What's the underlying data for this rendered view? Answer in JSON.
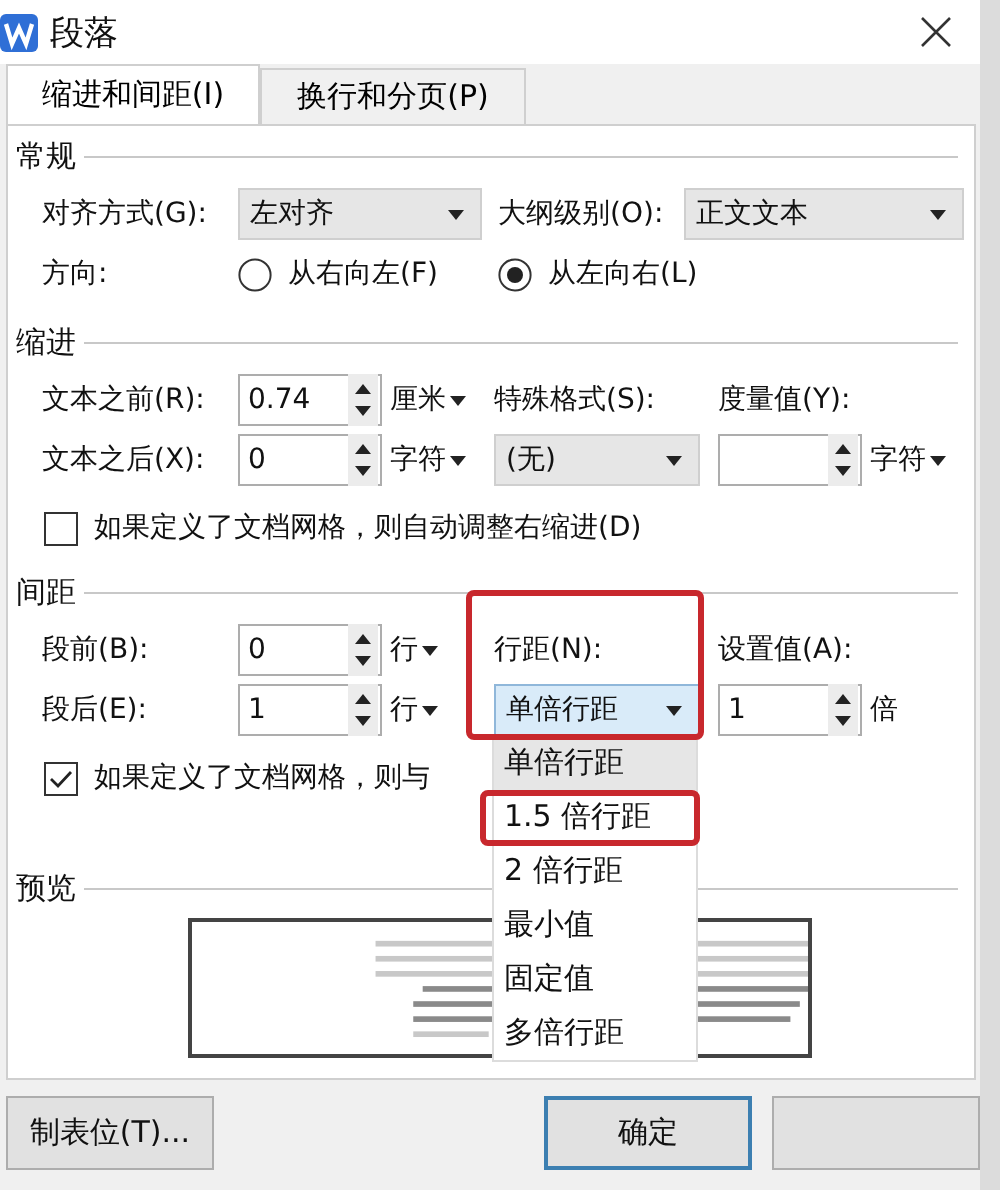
{
  "window": {
    "title": "段落"
  },
  "tabs": [
    {
      "label": "缩进和间距(I)",
      "selected": true
    },
    {
      "label": "换行和分页(P)",
      "selected": false
    }
  ],
  "general": {
    "heading": "常规",
    "alignment": {
      "label": "对齐方式(G):",
      "value": "左对齐"
    },
    "outline_level": {
      "label": "大纲级别(O):",
      "value": "正文文本"
    },
    "direction": {
      "label": "方向:",
      "options": [
        {
          "label": "从右向左(F)",
          "selected": false
        },
        {
          "label": "从左向右(L)",
          "selected": true
        }
      ]
    }
  },
  "indent": {
    "heading": "缩进",
    "before": {
      "label": "文本之前(R):",
      "value": "0.74",
      "unit": "厘米",
      "unit_menu": true
    },
    "after": {
      "label": "文本之后(X):",
      "value": "0",
      "unit": "字符",
      "unit_menu": true
    },
    "special": {
      "label": "特殊格式(S):",
      "value": "(无)"
    },
    "measure": {
      "label": "度量值(Y):",
      "unit": "字符",
      "unit_menu": true
    },
    "grid_checkbox": {
      "label": "如果定义了文档网格，则自动调整右缩进(D)",
      "checked": false
    }
  },
  "spacing": {
    "heading": "间距",
    "before": {
      "label": "段前(B):",
      "value": "0",
      "unit": "行",
      "unit_menu": true
    },
    "after": {
      "label": "段后(E):",
      "value": "1",
      "unit": "行",
      "unit_menu": true
    },
    "line_spacing": {
      "label": "行距(N):",
      "value": "单倍行距",
      "expanded": true,
      "highlighted": true,
      "options": [
        {
          "label": "单倍行距",
          "selected": true,
          "highlighted": false
        },
        {
          "label": "1.5 倍行距",
          "selected": false,
          "highlighted": true
        },
        {
          "label": "2 倍行距",
          "selected": false,
          "highlighted": false
        },
        {
          "label": "最小值",
          "selected": false,
          "highlighted": false
        },
        {
          "label": "固定值",
          "selected": false,
          "highlighted": false
        },
        {
          "label": "多倍行距",
          "selected": false,
          "highlighted": false
        }
      ]
    },
    "set_value": {
      "label": "设置值(A):",
      "value": "1",
      "unit": "倍",
      "unit_menu": false
    },
    "grid_checkbox": {
      "label": "如果定义了文档网格，则与",
      "checked": true
    }
  },
  "preview": {
    "heading": "预览"
  },
  "buttons": [
    {
      "label": "制表位(T)...",
      "kind": "normal"
    },
    {
      "label": "确定",
      "kind": "default"
    },
    {
      "kind": "normal"
    }
  ]
}
